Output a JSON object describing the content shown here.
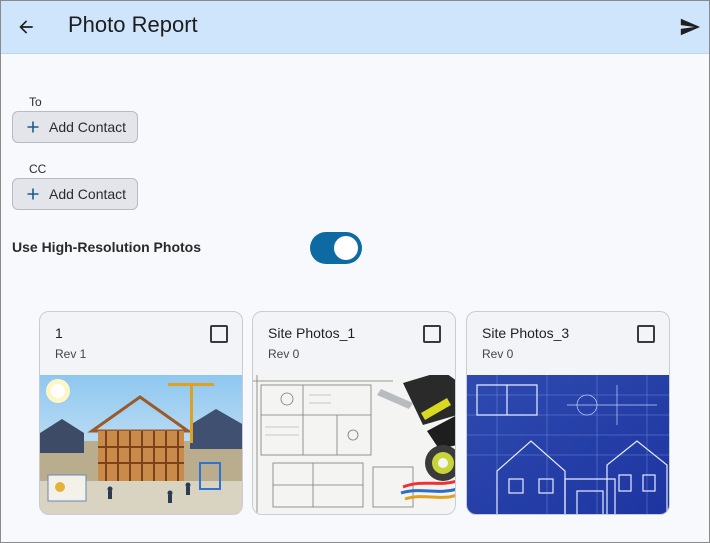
{
  "header": {
    "title": "Photo Report",
    "back_icon": "arrow-back-icon",
    "send_icon": "send-icon",
    "background": "#cfe5fb"
  },
  "recipients": {
    "to_label": "To",
    "to_button": "Add Contact",
    "cc_label": "CC",
    "cc_button": "Add Contact"
  },
  "high_res": {
    "label": "Use High-Resolution Photos",
    "enabled": true,
    "accent": "#0e6aa3"
  },
  "photos": [
    {
      "title": "1",
      "rev": "Rev 1",
      "checked": false,
      "image": "house-construction-illustration"
    },
    {
      "title": "Site Photos_1",
      "rev": "Rev 0",
      "checked": false,
      "image": "blueprint-with-tools"
    },
    {
      "title": "Site Photos_3",
      "rev": "Rev 0",
      "checked": false,
      "image": "blue-blueprint-house"
    }
  ]
}
